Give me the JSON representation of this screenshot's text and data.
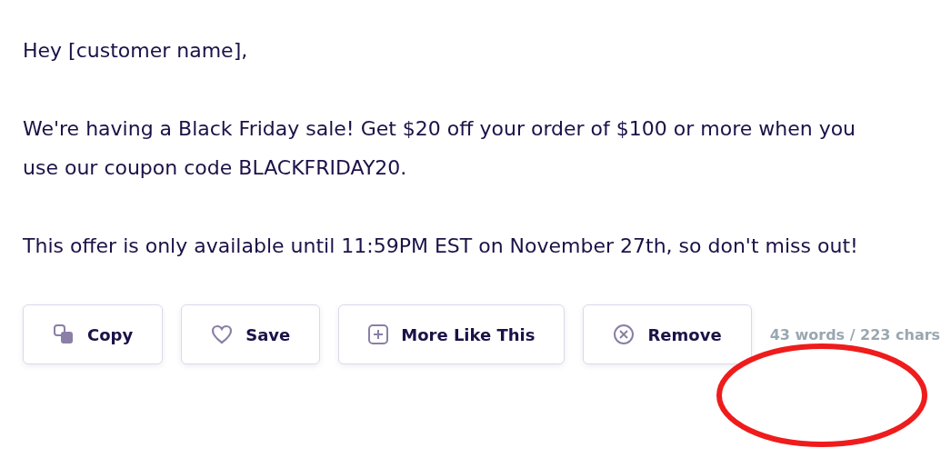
{
  "message": {
    "paragraphs": [
      "Hey [customer name],",
      "We're having a Black Friday sale! Get $20 off your order of $100 or more when you use our coupon code BLACKFRIDAY20.",
      "This offer is only available until 11:59PM EST on November 27th, so don't miss out!"
    ]
  },
  "actions": [
    {
      "kind": "copy",
      "label": "Copy"
    },
    {
      "kind": "save",
      "label": "Save"
    },
    {
      "kind": "more",
      "label": "More Like This"
    },
    {
      "kind": "remove",
      "label": "Remove"
    }
  ],
  "stats": "43 words / 223 chars"
}
